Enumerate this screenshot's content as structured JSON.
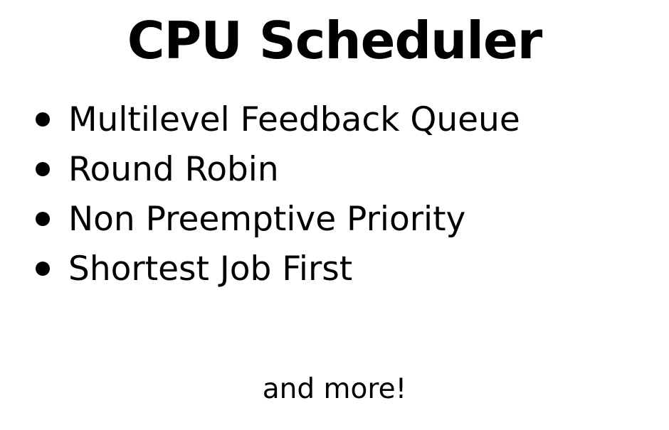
{
  "title": "CPU Scheduler",
  "items": [
    {
      "label": "Multilevel Feedback Queue"
    },
    {
      "label": "Round Robin"
    },
    {
      "label": "Non Preemptive Priority"
    },
    {
      "label": "Shortest Job First"
    }
  ],
  "footer": "and more!",
  "colors": {
    "background": "#ffffff",
    "text": "#000000"
  }
}
